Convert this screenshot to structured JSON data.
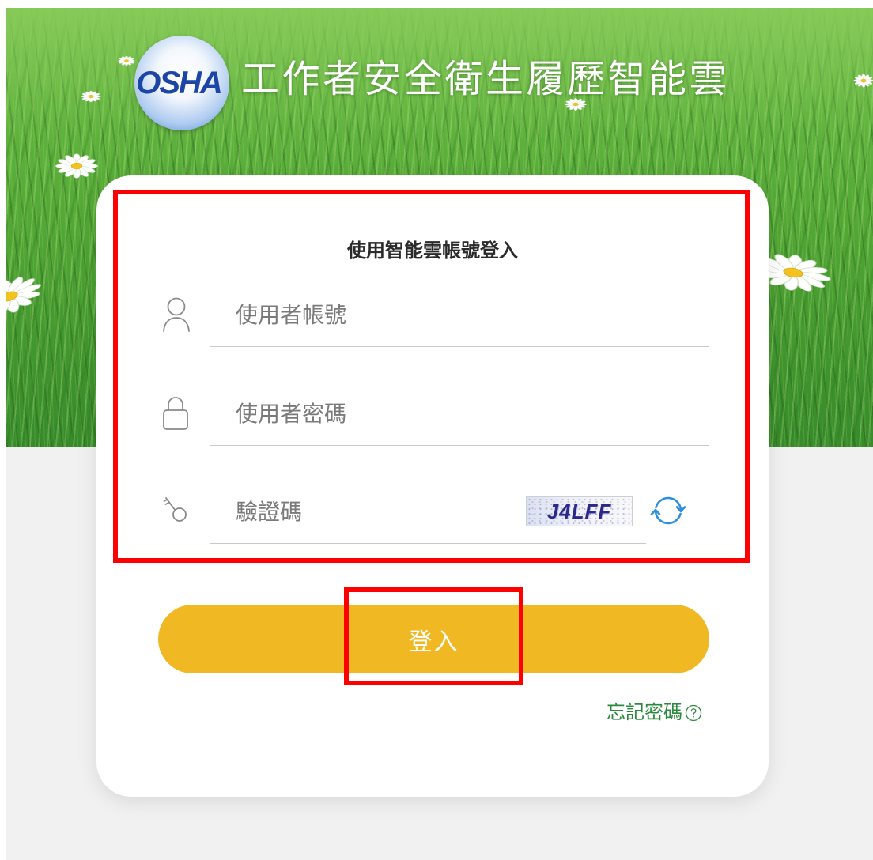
{
  "header": {
    "logo_text": "OSHA",
    "title": "工作者安全衛生履歷智能雲"
  },
  "login_form": {
    "heading": "使用智能雲帳號登入",
    "username": {
      "placeholder": "使用者帳號",
      "value": "",
      "icon": "user-icon"
    },
    "password": {
      "placeholder": "使用者密碼",
      "value": "",
      "icon": "lock-icon"
    },
    "captcha": {
      "placeholder": "驗證碼",
      "value": "",
      "icon": "key-icon",
      "image_text": "J4LFF",
      "refresh_icon": "refresh-icon"
    },
    "submit_label": "登入",
    "forgot_password_label": "忘記密碼",
    "forgot_password_icon": "question-circle-icon"
  },
  "colors": {
    "page_background": "#f1f1f1",
    "submit_button": "#f0b823",
    "forgot_link": "#2b8a3e",
    "refresh_icon": "#2f8fdc",
    "icon_gray": "#8a8a8a",
    "annotation_box": "#ff0000"
  }
}
